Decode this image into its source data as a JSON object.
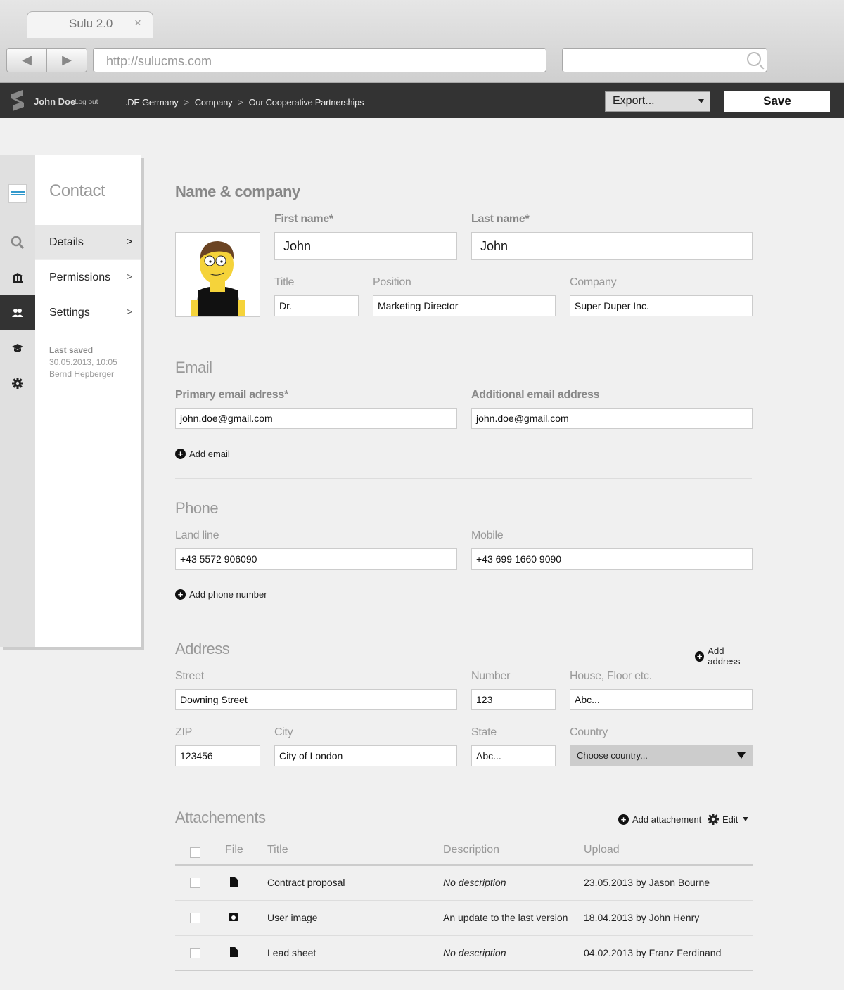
{
  "browser": {
    "tab_title": "Sulu 2.0",
    "tab_close": "×",
    "url": "http://sulucms.com",
    "back_glyph": "◀",
    "forward_glyph": "▶"
  },
  "topbar": {
    "user": "John Doe",
    "logout": "Log out",
    "breadcrumbs": [
      ".DE Germany",
      "Company",
      "Our Cooperative Partnerships"
    ],
    "crumb_sep": ">",
    "export_label": "Export...",
    "save_label": "Save"
  },
  "sidebar": {
    "title": "Contact",
    "items": [
      {
        "label": "Details",
        "chevron": ">"
      },
      {
        "label": "Permissions",
        "chevron": ">"
      },
      {
        "label": "Settings",
        "chevron": ">"
      }
    ],
    "last_saved_label": "Last saved",
    "last_saved_date": "30.05.2013, 10:05",
    "last_saved_by": "Bernd Hepberger"
  },
  "name_company": {
    "title": "Name & company",
    "first_name_label": "First name*",
    "first_name": "John",
    "last_name_label": "Last name*",
    "last_name": "John",
    "title_label": "Title",
    "title_value": "Dr.",
    "position_label": "Position",
    "position_value": "Marketing Director",
    "company_label": "Company",
    "company_value": "Super Duper Inc."
  },
  "email": {
    "title": "Email",
    "primary_label": "Primary email adress*",
    "primary_value": "john.doe@gmail.com",
    "additional_label": "Additional email address",
    "additional_value": "john.doe@gmail.com",
    "add_label": "Add email"
  },
  "phone": {
    "title": "Phone",
    "landline_label": "Land line",
    "landline_value": "+43 5572 906090",
    "mobile_label": "Mobile",
    "mobile_value": "+43 699 1660 9090",
    "add_label": "Add phone number"
  },
  "address": {
    "title": "Address",
    "add_label": "Add address",
    "street_label": "Street",
    "street_value": "Downing Street",
    "number_label": "Number",
    "number_value": "123",
    "house_label": "House, Floor etc.",
    "house_value": "Abc...",
    "zip_label": "ZIP",
    "zip_value": "123456",
    "city_label": "City",
    "city_value": "City of London",
    "state_label": "State",
    "state_value": "Abc...",
    "country_label": "Country",
    "country_value": "Choose country..."
  },
  "attachments": {
    "title": "Attachements",
    "add_label": "Add attachement",
    "edit_label": "Edit",
    "columns": [
      "File",
      "Title",
      "Description",
      "Upload"
    ],
    "rows": [
      {
        "file_icon": "document-icon",
        "title": "Contract proposal",
        "description": "No description",
        "upload": "23.05.2013 by Jason Bourne"
      },
      {
        "file_icon": "camera-icon",
        "title": "User image",
        "description": "An update to the last version",
        "upload": "18.04.2013 by John Henry"
      },
      {
        "file_icon": "document-icon",
        "title": "Lead sheet",
        "description": "No description",
        "upload": "04.02.2013 by Franz Ferdinand"
      }
    ]
  },
  "colors": {
    "topbar": "#333333",
    "sidebar_active": "#333333",
    "label_gray": "#999999"
  }
}
